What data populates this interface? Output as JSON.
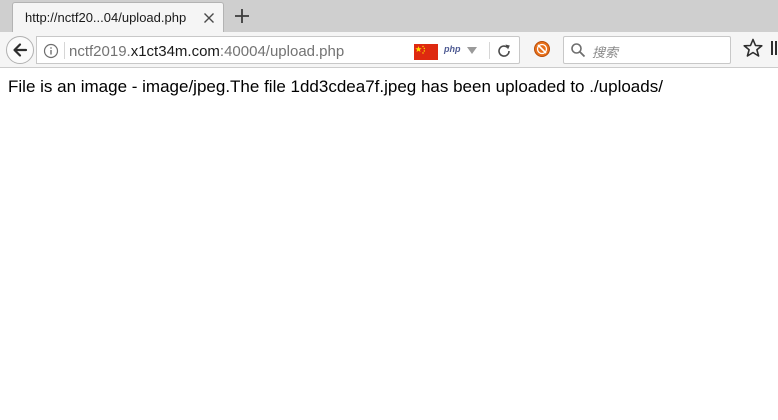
{
  "tab": {
    "title": "http://nctf20...04/upload.php"
  },
  "address_bar": {
    "url_prefix": "nctf2019.",
    "url_host": "x1ct34m.com",
    "url_suffix": ":40004/upload.php",
    "php_badge": "php"
  },
  "search": {
    "placeholder": "搜索"
  },
  "page": {
    "message": "File is an image - image/jpeg.The file 1dd3cdea7f.jpeg has been uploaded to ./uploads/"
  },
  "icons": {
    "tab_close": "close-icon",
    "new_tab": "plus-icon",
    "back": "back-arrow-icon",
    "info": "info-icon",
    "flag": "china-flag-icon",
    "dropdown": "chevron-down-icon",
    "reload": "reload-icon",
    "addon": "blocked-addon-icon",
    "search": "search-icon",
    "bookmark": "star-icon",
    "bookmark_menu": "bookmarks-menu-icon"
  },
  "colors": {
    "tabstrip_bg": "#cfcfcf",
    "toolbar_bg": "#f5f5f5",
    "url_muted": "#737373",
    "url_host": "#1a1a1a",
    "flag_red": "#de2910",
    "flag_yellow": "#ffde00",
    "addon_orange": "#e8701a"
  }
}
